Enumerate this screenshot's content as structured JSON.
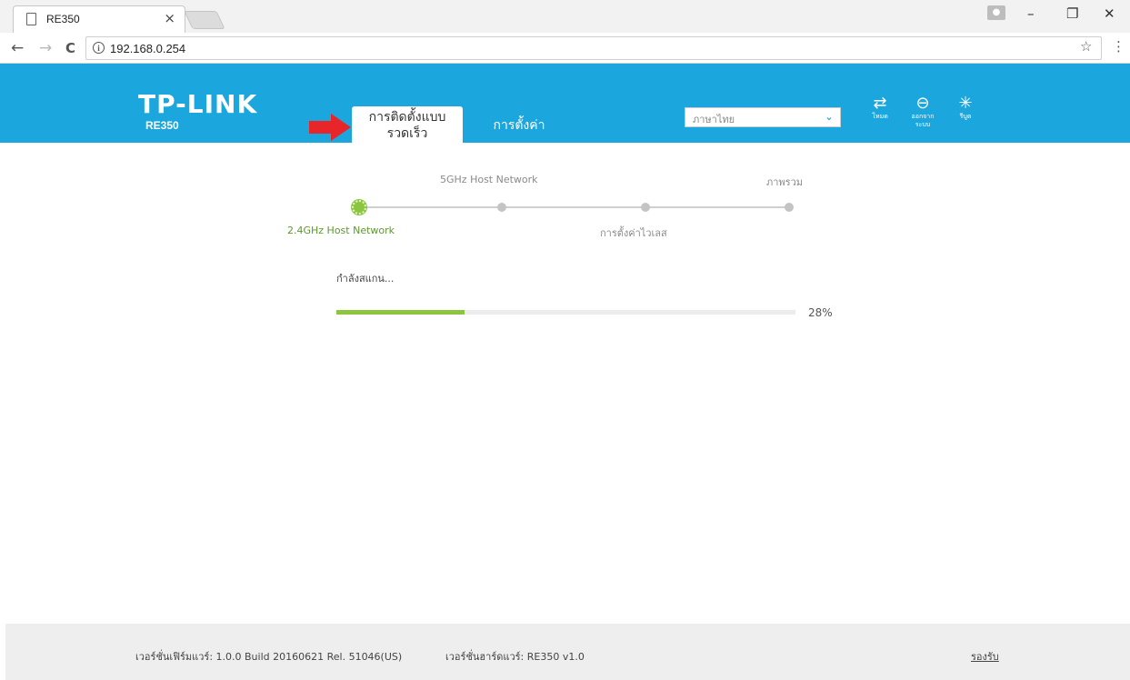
{
  "browser": {
    "tab_title": "RE350",
    "tab_close": "×",
    "url": "192.168.0.254",
    "back": "←",
    "forward": "→",
    "reload": "C",
    "info": "i",
    "star": "☆",
    "menu": "⋮",
    "minimize": "–",
    "restore": "❐",
    "close": "✕"
  },
  "header": {
    "brand": "TP-LINK",
    "model": "RE350",
    "tabs": [
      {
        "label_line1": "การติดตั้งแบบ",
        "label_line2": "รวดเร็ว",
        "active": true
      },
      {
        "label": "การตั้งค่า",
        "active": false
      }
    ],
    "language": {
      "selected": "ภาษาไทย"
    },
    "icons": [
      {
        "name": "mode-icon",
        "glyph": "⇄",
        "label": "โหมด"
      },
      {
        "name": "logout-icon",
        "glyph": "⊖",
        "label": "ออกจาก ระบบ"
      },
      {
        "name": "reboot-icon",
        "glyph": "✳",
        "label": "รีบูต"
      }
    ],
    "accent_color": "#1ba6dd"
  },
  "wizard": {
    "steps": [
      {
        "label": "2.4GHz Host Network",
        "status": "current"
      },
      {
        "label": "5GHz Host Network",
        "status": "pending"
      },
      {
        "label": "การตั้งค่าไวเลส",
        "status": "pending"
      },
      {
        "label": "ภาพรวม",
        "status": "pending"
      }
    ],
    "scan_status": "กำลังสแกน...",
    "progress": {
      "value": 28,
      "label": "28%"
    },
    "progress_color": "#8cc63f"
  },
  "footer": {
    "firmware": "เวอร์ชั่นเฟิร์มแวร์: 1.0.0 Build 20160621 Rel. 51046(US)",
    "hardware": "เวอร์ชั่นฮาร์ดแวร์: RE350 v1.0",
    "support_link": "รองรับ"
  }
}
